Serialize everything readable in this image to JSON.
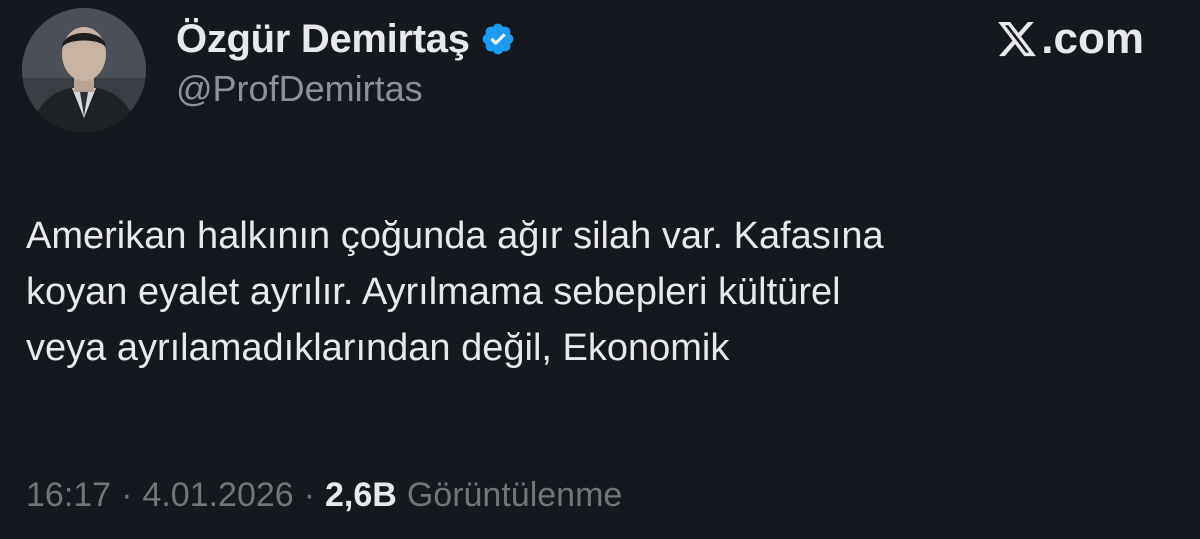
{
  "author": {
    "display_name": "Özgür Demirtaş",
    "handle": "@ProfDemirtas",
    "verified": true,
    "verified_color": "#1d9bf0"
  },
  "brand": {
    "text": ".com"
  },
  "tweet": {
    "text": "Amerikan halkının çoğunda ağır silah var. Kafasına\nkoyan eyalet ayrılır. Ayrılmama sebepleri kültürel\nveya ayrılamadıklarından değil, Ekonomik"
  },
  "meta": {
    "time": "16:17",
    "separator": "·",
    "date": "4.01.2026",
    "views_count": "2,6B",
    "views_label": "Görüntülenme"
  },
  "colors": {
    "background": "#16181f",
    "text_primary": "#e7e9ea",
    "text_secondary": "#71767b"
  }
}
